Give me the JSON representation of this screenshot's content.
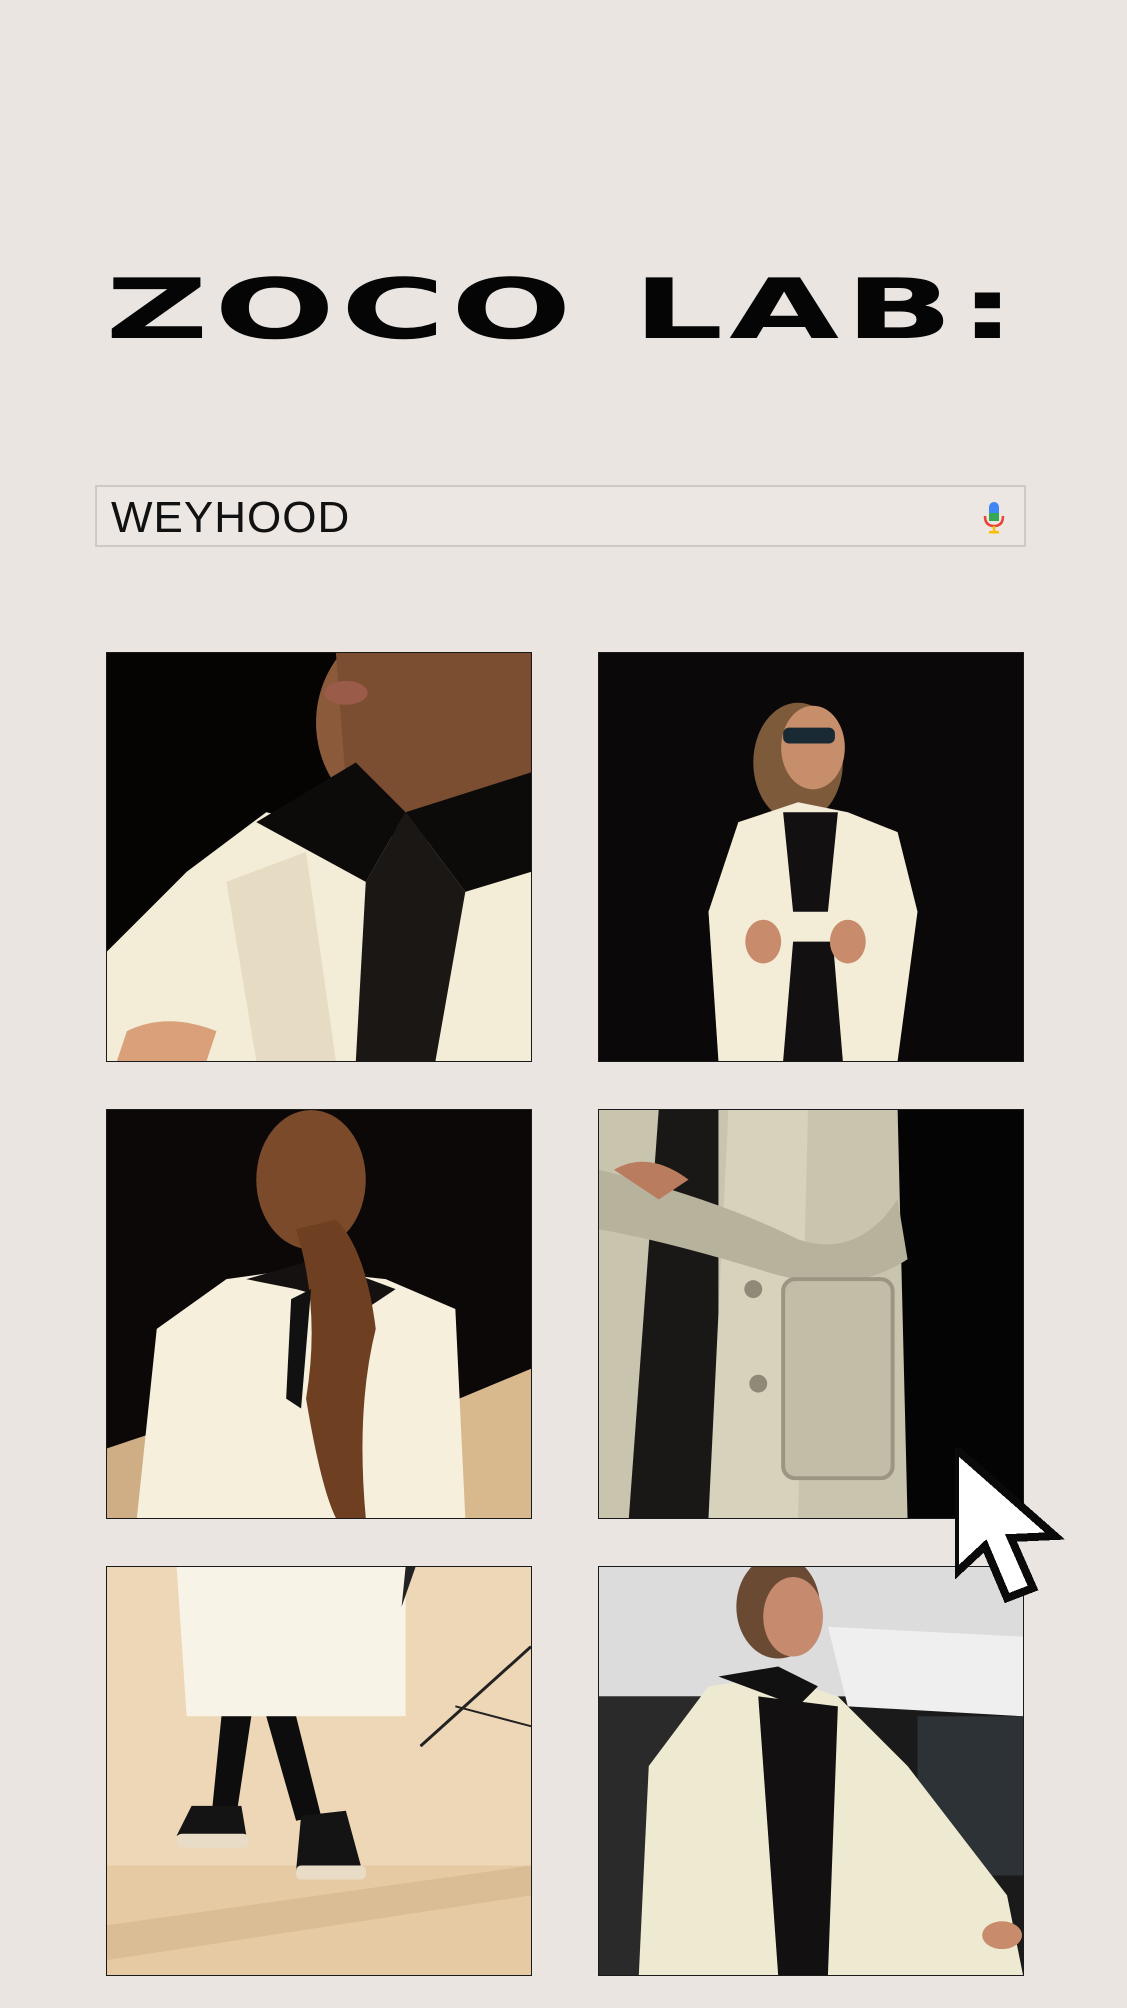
{
  "header": {
    "title": "ZOCO LAB:"
  },
  "search": {
    "query": "WEYHOOD",
    "mic_icon": "microphone-icon"
  },
  "gallery": {
    "photos": [
      {
        "subject": "white coat with black lapel close-up"
      },
      {
        "subject": "woman with sunglasses in white coat"
      },
      {
        "subject": "woman with ponytail from behind"
      },
      {
        "subject": "coat pocket detail"
      },
      {
        "subject": "walking in black boots on sand"
      },
      {
        "subject": "woman leaning in white coat"
      }
    ]
  },
  "cursor": {
    "icon": "pointer-arrow-icon"
  },
  "colors": {
    "background": "#ebe5e1",
    "title": "#050505",
    "coat": "#f3ecd8"
  }
}
